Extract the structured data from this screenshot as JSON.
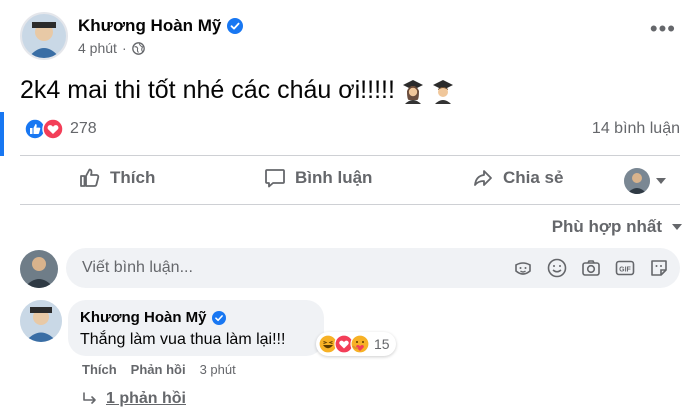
{
  "post": {
    "author": "Khương Hoàn Mỹ",
    "time": "4 phút",
    "text": "2k4 mai thi tốt nhé các cháu ơi!!!!!",
    "reaction_count": "278",
    "comment_count": "14 bình luận"
  },
  "actions": {
    "like": "Thích",
    "comment": "Bình luận",
    "share": "Chia sẻ"
  },
  "sort": {
    "label": "Phù hợp nhất"
  },
  "comment_input": {
    "placeholder": "Viết bình luận..."
  },
  "comment": {
    "author": "Khương Hoàn Mỹ",
    "text": "Thắng làm vua thua làm lại!!!",
    "reaction_count": "15",
    "like": "Thích",
    "reply": "Phản hồi",
    "time": "3 phút",
    "replies": "1 phản hồi"
  },
  "colors": {
    "accent": "#1877f2",
    "secondary_text": "#65676b",
    "input_bg": "#f0f2f5",
    "love": "#f33e58"
  }
}
